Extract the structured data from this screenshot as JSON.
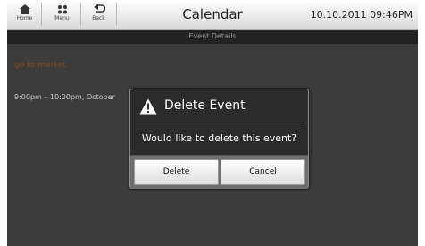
{
  "header": {
    "home_label": "Home",
    "menu_label": "Menu",
    "back_label": "Back",
    "title": "Calendar",
    "datetime": "10.10.2011 09:46PM"
  },
  "subheader": {
    "title": "Event Details"
  },
  "event": {
    "title": "go to market",
    "time": "9:00pm – 10:00pm, October"
  },
  "dialog": {
    "icon": "warning-icon",
    "title": "Delete Event",
    "message": "Would like to delete this event?",
    "delete_label": "Delete",
    "cancel_label": "Cancel"
  },
  "colors": {
    "accent_pin": "#e0348a",
    "event_title": "#8b4a1d"
  }
}
